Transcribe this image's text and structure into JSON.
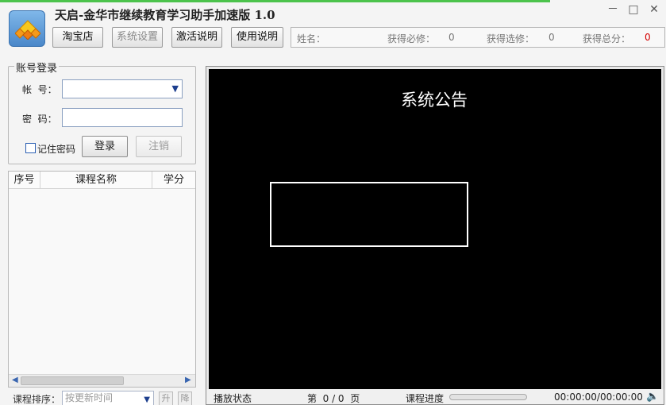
{
  "app": {
    "title": "天启-金华市继续教育学习助手加速版 1.0",
    "logo_icon": "diamond-stack-logo",
    "accent_color": "#4cc34c"
  },
  "window_controls": {
    "min": "－",
    "max": "□",
    "close": "✕"
  },
  "toolbar": {
    "taobao": "淘宝店",
    "settings": "系统设置",
    "activate": "激活说明",
    "usage": "使用说明"
  },
  "info": {
    "name_label": "姓名：",
    "required_label": "获得必修：",
    "required_value": "0",
    "elective_label": "获得选修：",
    "elective_value": "0",
    "total_label": "获得总分：",
    "total_value": "0",
    "total_color": "#d40000"
  },
  "login": {
    "legend": "账号登录",
    "account_label": "帐  号：",
    "account_value": "",
    "password_label": "密  码：",
    "password_value": "",
    "remember_label": "记住密码",
    "remember_checked": false,
    "login_button": "登录",
    "logout_button": "注销"
  },
  "course_table": {
    "columns": [
      "序号",
      "课程名称",
      "学分"
    ],
    "rows": []
  },
  "sort": {
    "label": "课程排序：",
    "selected": "按更新时间",
    "asc": "升",
    "desc": "降"
  },
  "player": {
    "announcement_title": "系统公告",
    "status_label": "播放状态",
    "page_text": "第  0 / 0  页",
    "progress_label": "课程进度",
    "progress_value": 0,
    "time_text": "00:00:00/00:00:00",
    "volume_icon": "speaker-icon"
  }
}
